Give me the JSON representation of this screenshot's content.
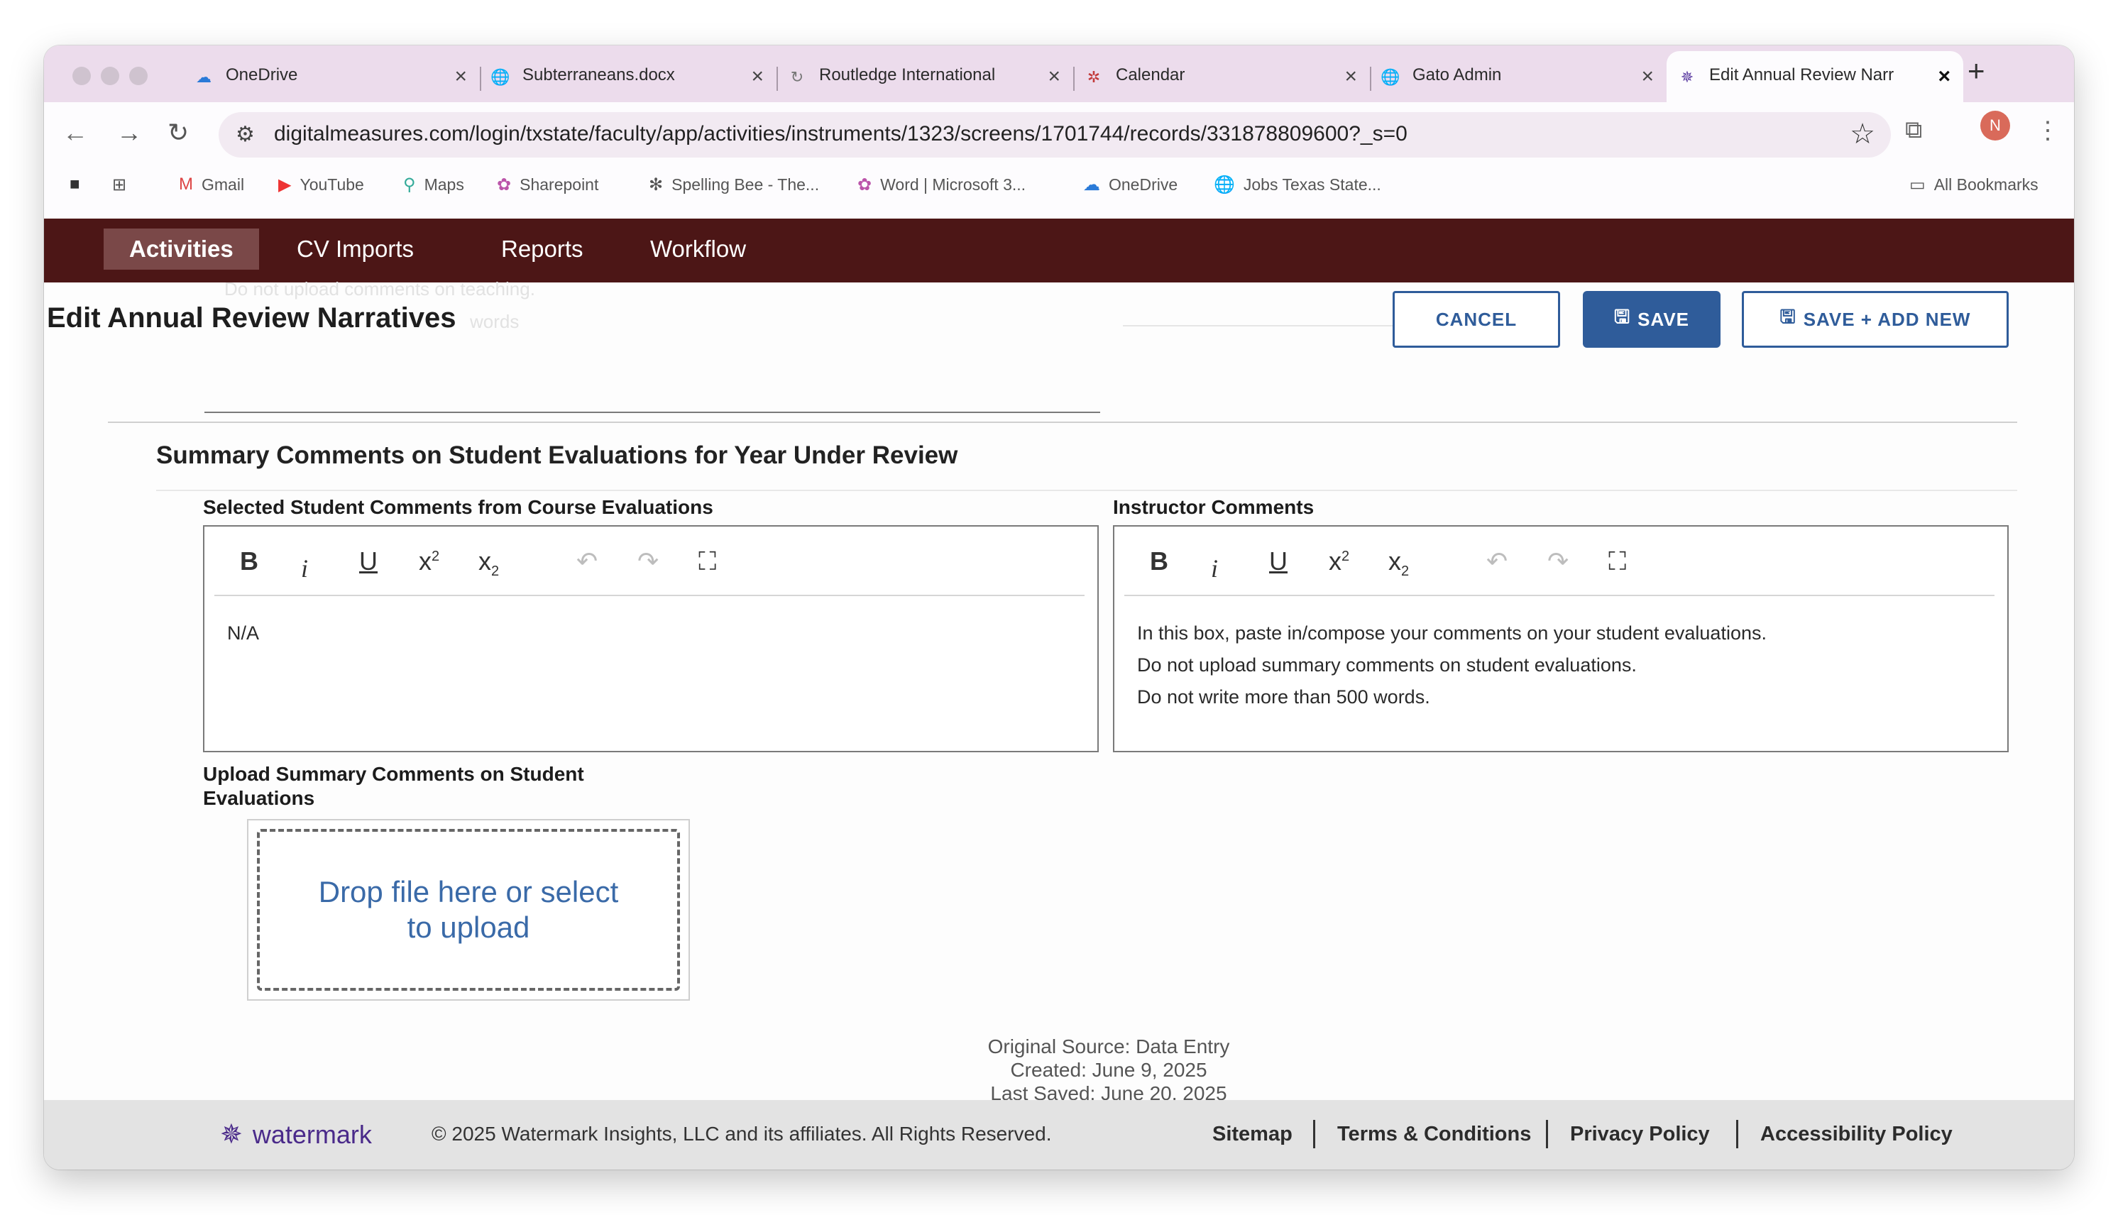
{
  "browser": {
    "tabs": [
      {
        "label": "OneDrive",
        "icon": "cloud-icon",
        "color": "#2a7ad8"
      },
      {
        "label": "Subterraneans.docx",
        "icon": "globe-icon",
        "color": "#555555"
      },
      {
        "label": "Routledge International",
        "icon": "loading-icon",
        "color": "#777777"
      },
      {
        "label": "Calendar",
        "icon": "calendar-icon",
        "color": "#c23a3a"
      },
      {
        "label": "Gato Admin",
        "icon": "globe-icon",
        "color": "#555555"
      },
      {
        "label": "Edit Annual Review Narr",
        "icon": "watermark-icon",
        "color": "#5a3aa0"
      }
    ],
    "url": "digitalmeasures.com/login/txstate/faculty/app/activities/instruments/1323/screens/1701744/records/331878809600?_s=0",
    "avatar_letter": "N",
    "bookmarks": [
      {
        "label": "Gmail"
      },
      {
        "label": "YouTube"
      },
      {
        "label": "Maps"
      },
      {
        "label": "Sharepoint"
      },
      {
        "label": "Spelling Bee - The..."
      },
      {
        "label": "Word | Microsoft 3..."
      },
      {
        "label": "OneDrive"
      },
      {
        "label": "Jobs Texas State..."
      }
    ],
    "all_bookmarks": "All Bookmarks"
  },
  "nav": {
    "items": [
      "Activities",
      "CV Imports",
      "Reports",
      "Workflow"
    ]
  },
  "page": {
    "title": "Edit Annual Review Narratives",
    "cancel": "CANCEL",
    "save": "SAVE",
    "save_add_new": "SAVE + ADD NEW",
    "ghost_line1": "Do not upload comments on teaching.",
    "ghost_line2": "words"
  },
  "section": {
    "title": "Summary Comments on Student Evaluations for Year Under Review",
    "student_label": "Selected Student Comments from Course Evaluations",
    "student_text": "N/A",
    "instructor_label": "Instructor Comments",
    "instructor_lines": [
      "In this box, paste in/compose your comments on your student evaluations.",
      "Do not upload summary comments on student evaluations.",
      "Do not write more than 500 words."
    ],
    "upload_label_line1": "Upload Summary Comments on Student",
    "upload_label_line2": "Evaluations",
    "upload_prompt": "Drop file here or select to upload"
  },
  "meta": {
    "source": "Original Source: Data Entry",
    "created": "Created: June 9, 2025",
    "saved": "Last Saved: June 20, 2025"
  },
  "footer": {
    "brand": "watermark",
    "copyright": "© 2025 Watermark Insights, LLC and its affiliates. All Rights Reserved.",
    "links": [
      "Sitemap",
      "Terms & Conditions",
      "Privacy Policy",
      "Accessibility Policy"
    ]
  }
}
